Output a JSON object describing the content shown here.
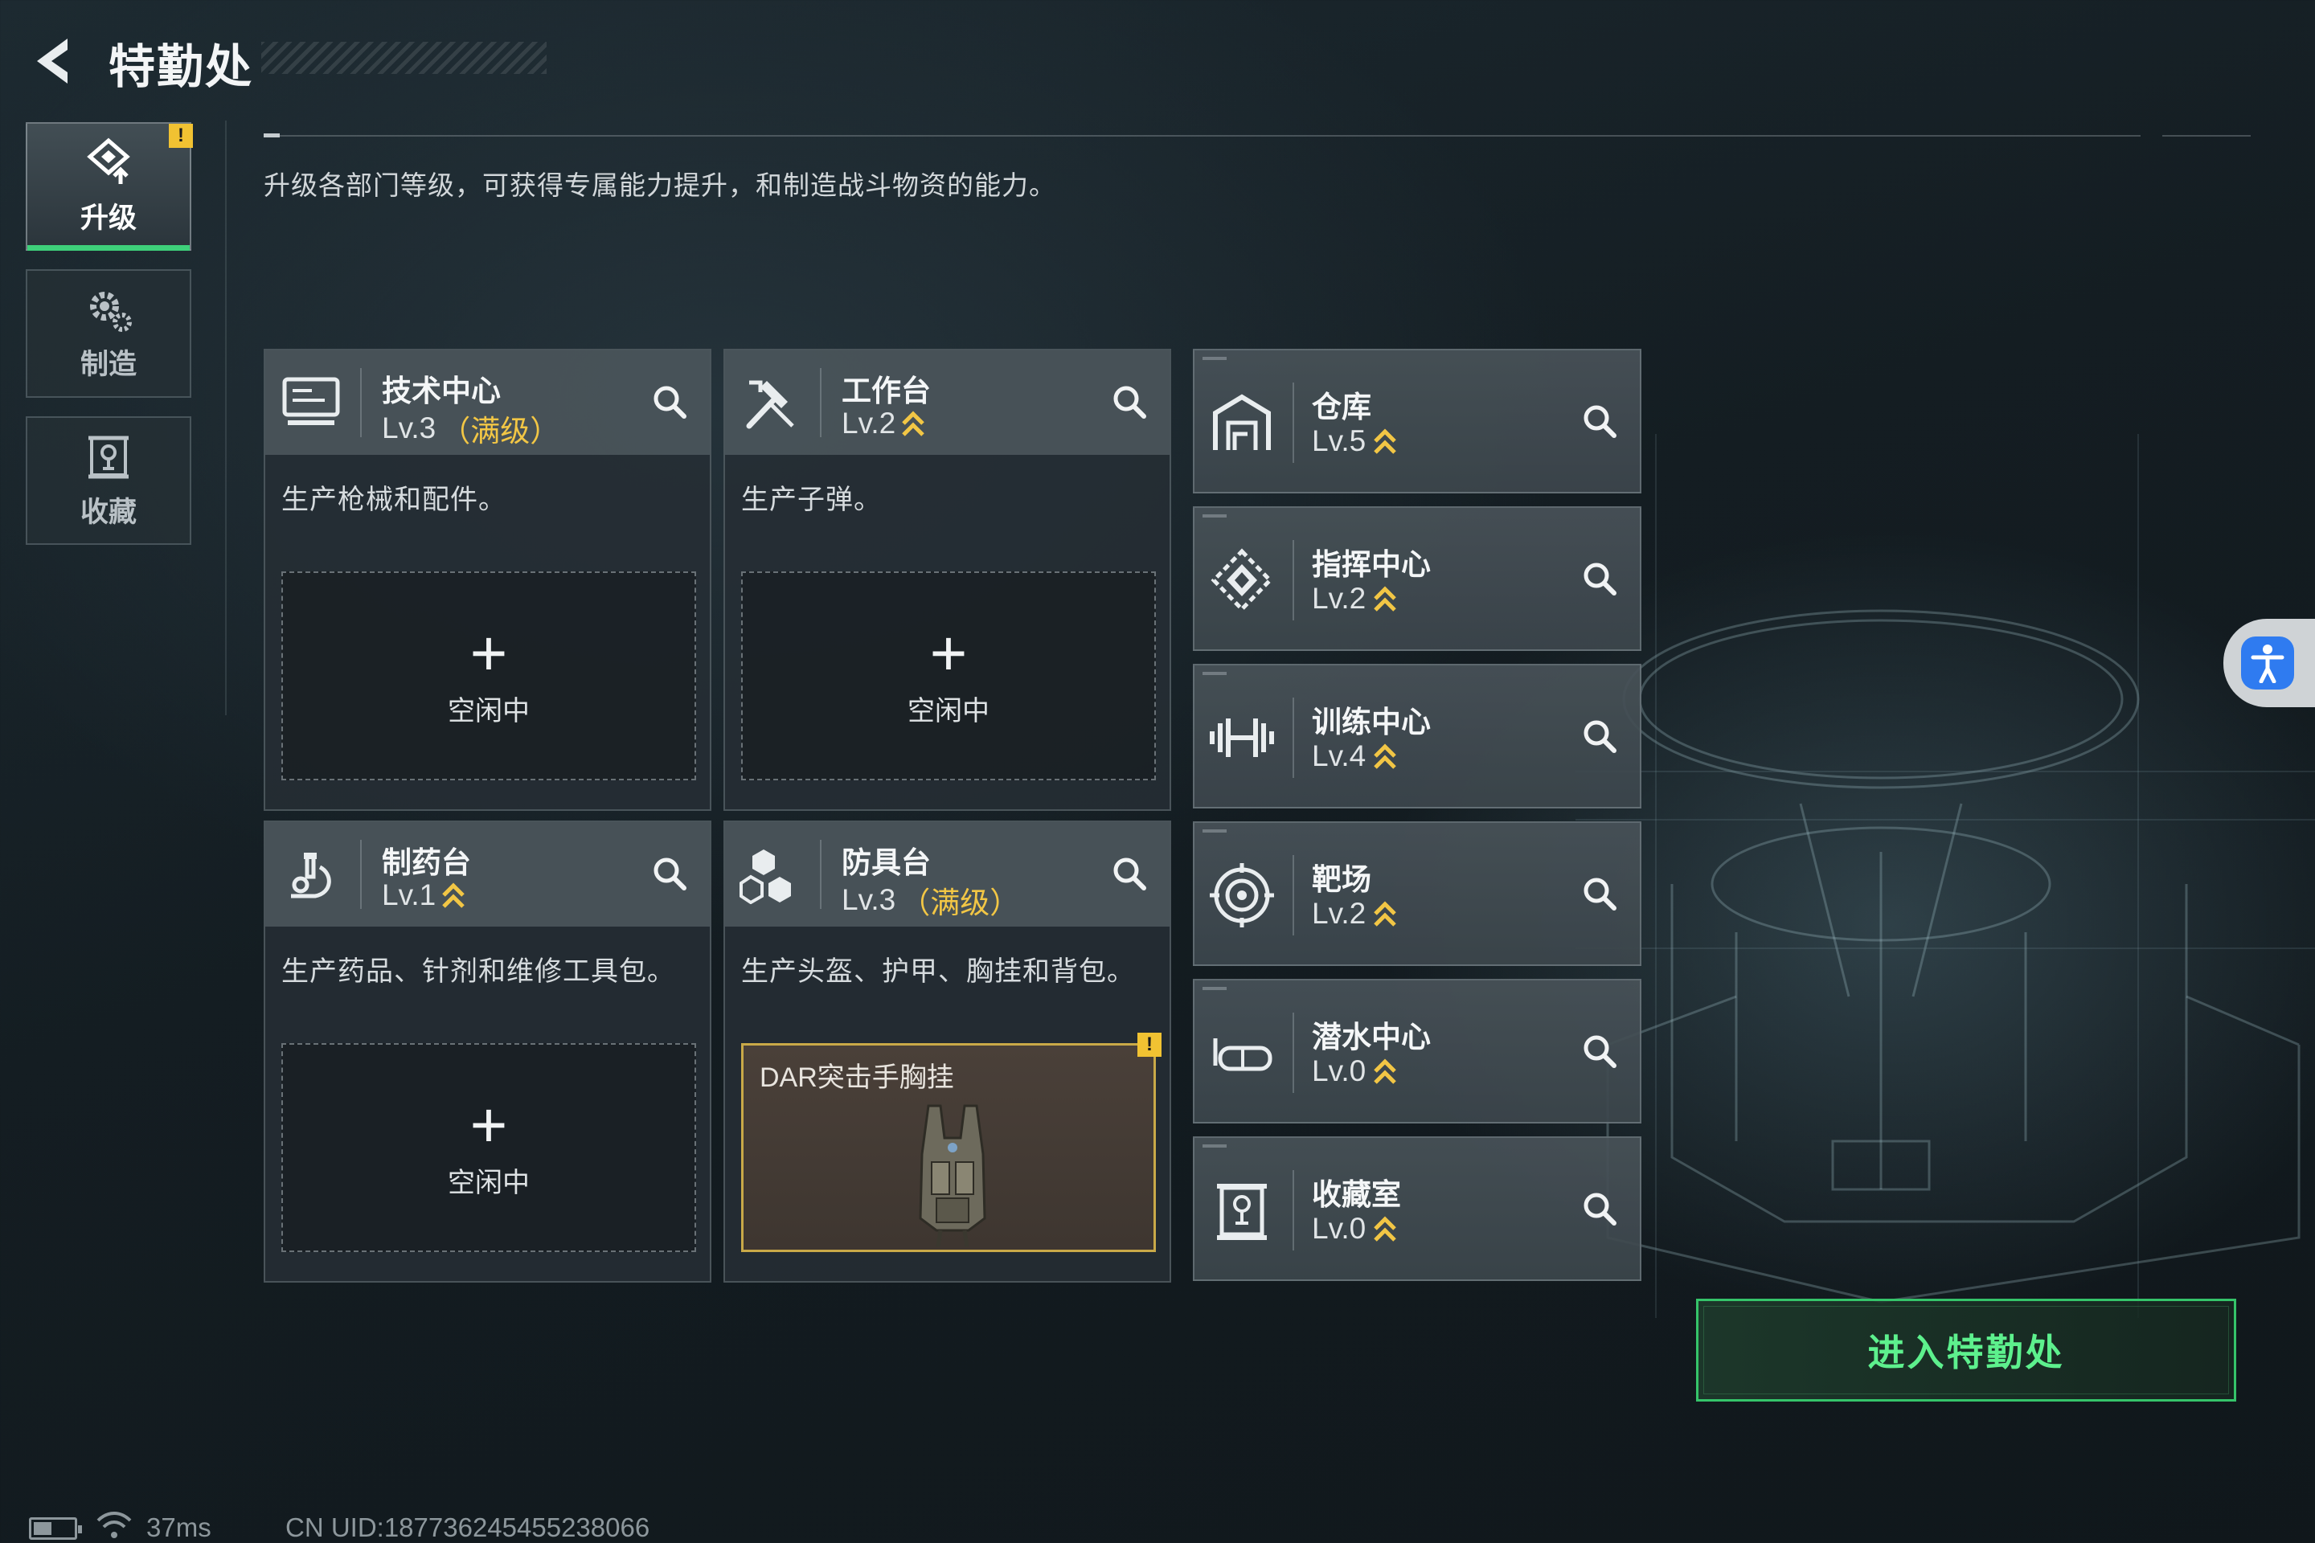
{
  "header": {
    "title": "特勤处"
  },
  "nav": {
    "tabs": [
      {
        "label": "升级",
        "icon": "upgrade-icon",
        "active": true,
        "warning": "!"
      },
      {
        "label": "制造",
        "icon": "gear-icon",
        "active": false
      },
      {
        "label": "收藏",
        "icon": "collection-icon",
        "active": false
      }
    ]
  },
  "description": "升级各部门等级，可获得专属能力提升，和制造战斗物资的能力。",
  "cards": [
    {
      "name": "技术中心",
      "level": "Lv.3",
      "max_label": "（满级）",
      "desc": "生产枪械和配件。",
      "slot_plus": "+",
      "slot_status": "空闲中",
      "icon": "computer-icon"
    },
    {
      "name": "工作台",
      "level": "Lv.2",
      "desc": "生产子弹。",
      "slot_plus": "+",
      "slot_status": "空闲中",
      "icon": "hammer-icon"
    },
    {
      "name": "制药台",
      "level": "Lv.1",
      "desc": "生产药品、针剂和维修工具包。",
      "slot_plus": "+",
      "slot_status": "空闲中",
      "icon": "microscope-icon"
    },
    {
      "name": "防具台",
      "level": "Lv.3",
      "max_label": "（满级）",
      "desc": "生产头盔、护甲、胸挂和背包。",
      "slot_item": "DAR突击手胸挂",
      "slot_warning": "!",
      "icon": "blocks-icon"
    }
  ],
  "facilities": [
    {
      "name": "仓库",
      "level": "Lv.5",
      "icon": "warehouse-icon"
    },
    {
      "name": "指挥中心",
      "level": "Lv.2",
      "icon": "command-icon"
    },
    {
      "name": "训练中心",
      "level": "Lv.4",
      "icon": "dumbbell-icon"
    },
    {
      "name": "靶场",
      "level": "Lv.2",
      "icon": "target-icon"
    },
    {
      "name": "潜水中心",
      "level": "Lv.0",
      "icon": "diving-mask-icon"
    },
    {
      "name": "收藏室",
      "level": "Lv.0",
      "icon": "collection-room-icon"
    }
  ],
  "enter_button": "进入特勤处",
  "status": {
    "ping": "37ms",
    "uid": "CN UID:187736245455238066"
  },
  "colors": {
    "accent_green": "#35c46a",
    "upgrade_gold": "#f2c645",
    "warning_yellow": "#f1c232",
    "a11y_blue": "#2f7bf0"
  }
}
